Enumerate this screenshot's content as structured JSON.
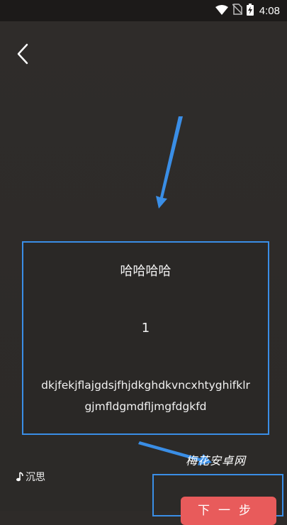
{
  "status_bar": {
    "time": "4:08",
    "icons": [
      "wifi-icon",
      "no-sim-icon",
      "battery-charging-icon"
    ]
  },
  "nav": {
    "back_icon": "chevron-left-icon"
  },
  "card": {
    "title": "哈哈哈哈",
    "number": "1",
    "body_line1": "dkjfekjflajgdsjfhjdkghdkvncxhtyghifklr",
    "body_line2": "gjmfldgmdfljmgfdgkfd"
  },
  "music": {
    "icon": "music-note-icon",
    "label": "沉思"
  },
  "next_button": {
    "label": "下一步"
  },
  "watermark": {
    "text": "梅花安卓网"
  },
  "colors": {
    "highlight_border": "#3a8ee6",
    "arrow": "#3a8ee6",
    "next_button_bg": "#e85b5b",
    "background": "#2e2b29"
  }
}
